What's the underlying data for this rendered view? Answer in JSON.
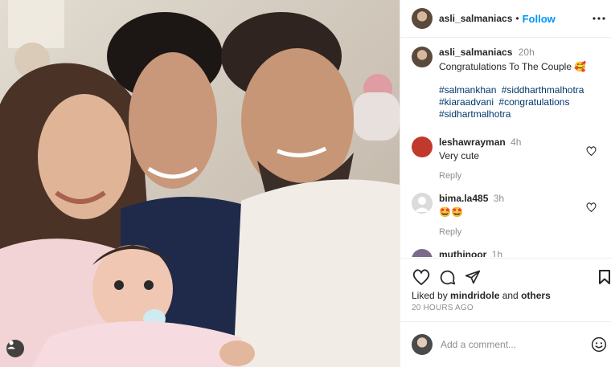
{
  "post": {
    "photo_alt": "",
    "username": "asli_salmaniacs",
    "separator": "•",
    "follow_label": "Follow",
    "caption": {
      "username": "asli_salmaniacs",
      "time": "20h",
      "text": "Congratulations To The Couple 🥰",
      "hashtags": [
        "#salmankhan",
        "#siddharthmalhotra",
        "#kiaraadvani",
        "#congratulations",
        "#sidhartmalhotra"
      ]
    },
    "comments": [
      {
        "username": "leshawrayman",
        "time": "4h",
        "text": "Very cute",
        "reply_label": "Reply",
        "avatar_color": "#c0392b"
      },
      {
        "username": "bima.la485",
        "time": "3h",
        "text": "🤩🤩",
        "reply_label": "Reply",
        "avatar_color": "#dbdbdb"
      },
      {
        "username": "muthinoor",
        "time": "1h",
        "text": "",
        "reply_label": "",
        "avatar_color": "#7b6a8a"
      }
    ],
    "likes": {
      "prefix": "Liked by ",
      "user": "mindridole",
      "joiner": " and ",
      "others": "others"
    },
    "time_ago": "20 HOURS AGO",
    "add_comment_placeholder": "Add a comment...",
    "icons": {
      "like": "heart-icon",
      "comment": "comment-icon",
      "share": "share-icon",
      "save": "bookmark-icon",
      "more": "more-options-icon",
      "emoji": "emoji-icon",
      "tag": "tagged-user-icon"
    },
    "colors": {
      "accent": "#0095f6",
      "hashtag": "#00376b",
      "muted": "#8e8e8e",
      "text": "#262626"
    }
  }
}
